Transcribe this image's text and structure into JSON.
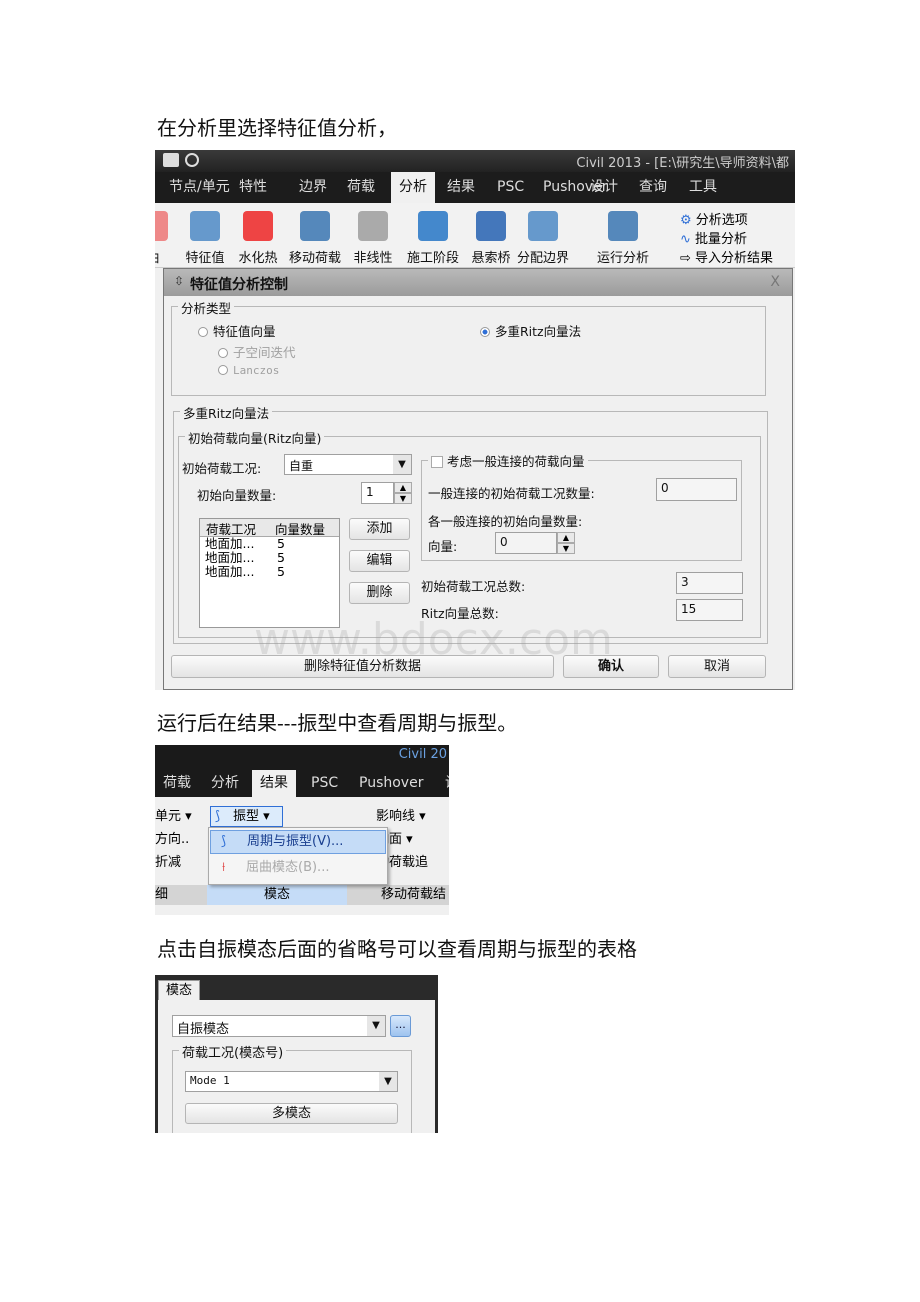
{
  "paragraphs": {
    "p1": "在分析里选择特征值分析，",
    "p2": "运行后在结果---振型中查看周期与振型。",
    "p3": "点击自振模态后面的省略号可以查看周期与振型的表格"
  },
  "shot1": {
    "window_title": "Civil 2013 - [E:\\研究生\\导师资料\\都",
    "tabs": [
      "节点/单元",
      "特性",
      "边界",
      "荷载",
      "分析",
      "结果",
      "PSC",
      "Pushover",
      "设计",
      "查询",
      "工具"
    ],
    "active_tab": "分析",
    "ribbon": [
      "曲",
      "特征值",
      "水化热",
      "移动荷载",
      "非线性",
      "施工阶段",
      "悬索桥",
      "分配边界",
      "运行分析"
    ],
    "ribbon_small": [
      "分析选项",
      "批量分析",
      "导入分析结果"
    ],
    "dialog": {
      "title": "特征值分析控制",
      "close": "X",
      "analysis_type_label": "分析类型",
      "radio_eigen": "特征值向量",
      "radio_subspace": "子空间迭代",
      "radio_lanczos": "Lanczos",
      "radio_ritz": "多重Ritz向量法",
      "ritz_group": "多重Ritz向量法",
      "initial_group": "初始荷载向量(Ritz向量)",
      "initial_case_label": "初始荷载工况:",
      "initial_case_value": "自重",
      "initial_count_label": "初始向量数量:",
      "initial_count_value": "1",
      "list_headers": [
        "荷载工况",
        "向量数量"
      ],
      "list_rows": [
        [
          "地面加...",
          "5"
        ],
        [
          "地面加...",
          "5"
        ],
        [
          "地面加...",
          "5"
        ]
      ],
      "add": "添加",
      "edit": "编辑",
      "delete": "删除",
      "general_link_check": "考虑一般连接的荷载向量",
      "general_case_count_label": "一般连接的初始荷载工况数量:",
      "general_case_count_value": "0",
      "general_vec_count_label": "各一般连接的初始向量数量:",
      "vector_label": "向量:",
      "vector_value": "0",
      "total_cases_label": "初始荷载工况总数:",
      "total_cases_value": "3",
      "ritz_total_label": "Ritz向量总数:",
      "ritz_total_value": "15",
      "delete_data": "删除特征值分析数据",
      "ok": "确认",
      "cancel": "取消"
    },
    "watermark": "www.bdocx.com"
  },
  "shot2": {
    "window_title": "Civil 20",
    "tabs": [
      "荷载",
      "分析",
      "结果",
      "PSC",
      "Pushover",
      "设"
    ],
    "active_tab": "结果",
    "left_items": [
      "单元 ▾",
      "方向..",
      "折减"
    ],
    "mode_button": "振型",
    "menu": [
      "周期与振型(V)...",
      "屈曲模态(B)..."
    ],
    "right_items": [
      "影响线 ▾",
      "响面 ▾",
      "动荷载追"
    ],
    "group_labels": [
      "细",
      "模态",
      "移动荷载结"
    ]
  },
  "shot3": {
    "tab": "模态",
    "select_value": "自振模态",
    "ellipsis": "...",
    "group_label": "荷载工况(模态号)",
    "mode_value": "Mode 1",
    "multi_button": "多模态"
  },
  "colors": {
    "accent": "#2f6fd6",
    "dark_bar": "#1e1e1e",
    "panel": "#f0f0f0",
    "highlight": "#c5dcf7"
  }
}
